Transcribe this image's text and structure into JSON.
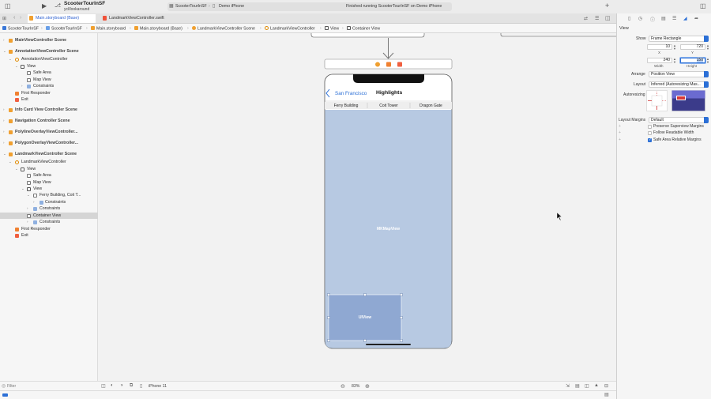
{
  "window": {
    "scheme_name": "ScooterTourInSF",
    "scheme_branch": "ycl/lookaround",
    "destination_target": "ScooterTourInSF",
    "destination_device": "Demo iPhone",
    "activity_status": "Finished running ScooterTourInSF on Demo iPhone"
  },
  "tabs": [
    {
      "label": "Main.storyboard (Base)",
      "active": true
    },
    {
      "label": "LandmarkViewController.swift",
      "active": false
    }
  ],
  "breadcrumbs": [
    "ScooterTourInSF",
    "ScooterTourInSF",
    "Main.storyboard",
    "Main.storyboard (Base)",
    "LandmarkViewController Scene",
    "LandmarkViewController",
    "View",
    "Container View"
  ],
  "outline": {
    "rows": [
      {
        "label": "MainViewController Scene",
        "kind": "scene"
      },
      {
        "label": "AnnotationViewController Scene",
        "kind": "scene"
      },
      {
        "label": "AnnotationViewController",
        "kind": "controller"
      },
      {
        "label": "View",
        "kind": "view"
      },
      {
        "label": "Safe Area",
        "kind": "item"
      },
      {
        "label": "Map View",
        "kind": "item"
      },
      {
        "label": "Constraints",
        "kind": "constraints"
      },
      {
        "label": "First Responder",
        "kind": "responder"
      },
      {
        "label": "Exit",
        "kind": "exit"
      },
      {
        "label": "Info Card View Controller Scene",
        "kind": "scene"
      },
      {
        "label": "Navigation Controller Scene",
        "kind": "scene"
      },
      {
        "label": "PolylineOverlayViewController...",
        "kind": "scene"
      },
      {
        "label": "PolygonOverlayViewController...",
        "kind": "scene"
      },
      {
        "label": "LandmarkViewController Scene",
        "kind": "scene"
      },
      {
        "label": "LandmarkViewController",
        "kind": "controller"
      },
      {
        "label": "View",
        "kind": "view"
      },
      {
        "label": "Safe Area",
        "kind": "item"
      },
      {
        "label": "Map View",
        "kind": "item"
      },
      {
        "label": "View",
        "kind": "view"
      },
      {
        "label": "Ferry Building, Coit T...",
        "kind": "segmented"
      },
      {
        "label": "Constraints",
        "kind": "constraints"
      },
      {
        "label": "Constraints",
        "kind": "constraints"
      },
      {
        "label": "Container View",
        "kind": "item",
        "selected": true
      },
      {
        "label": "Constraints",
        "kind": "constraints"
      },
      {
        "label": "First Responder",
        "kind": "responder"
      },
      {
        "label": "Exit",
        "kind": "exit"
      }
    ],
    "filter_placeholder": "Filter"
  },
  "canvas": {
    "nav_back_label": "San Francisco",
    "nav_title": "Highlights",
    "segments": [
      "Ferry Building",
      "Coit Tower",
      "Dragon Gate"
    ],
    "map_label": "MKMapView",
    "container_label": "UIView",
    "device_label": "iPhone 11",
    "zoom": "83%"
  },
  "inspector": {
    "section_title": "View",
    "show_label": "Show",
    "show_value": "Frame Rectangle",
    "x": "10",
    "y": "720",
    "width": "240",
    "height": "150",
    "x_label": "X",
    "y_label": "Y",
    "width_label": "Width",
    "height_label": "Height",
    "arrange_label": "Arrange",
    "arrange_value": "Position View",
    "layout_label": "Layout",
    "layout_value": "Inferred (Autoresizing Mas...",
    "autoresizing_label": "Autoresizing",
    "margins_label": "Layout Margins",
    "margins_value": "Default",
    "options": [
      {
        "label": "Preserve Superview Margins",
        "checked": false
      },
      {
        "label": "Follow Readable Width",
        "checked": false
      },
      {
        "label": "Safe Area Relative Margins",
        "checked": true
      }
    ]
  },
  "colors": {
    "accent": "#2b6fd6",
    "map_fill": "#b7c9e2",
    "container_fill": "#8fa8d2",
    "scene_icon": "#f0a030"
  }
}
